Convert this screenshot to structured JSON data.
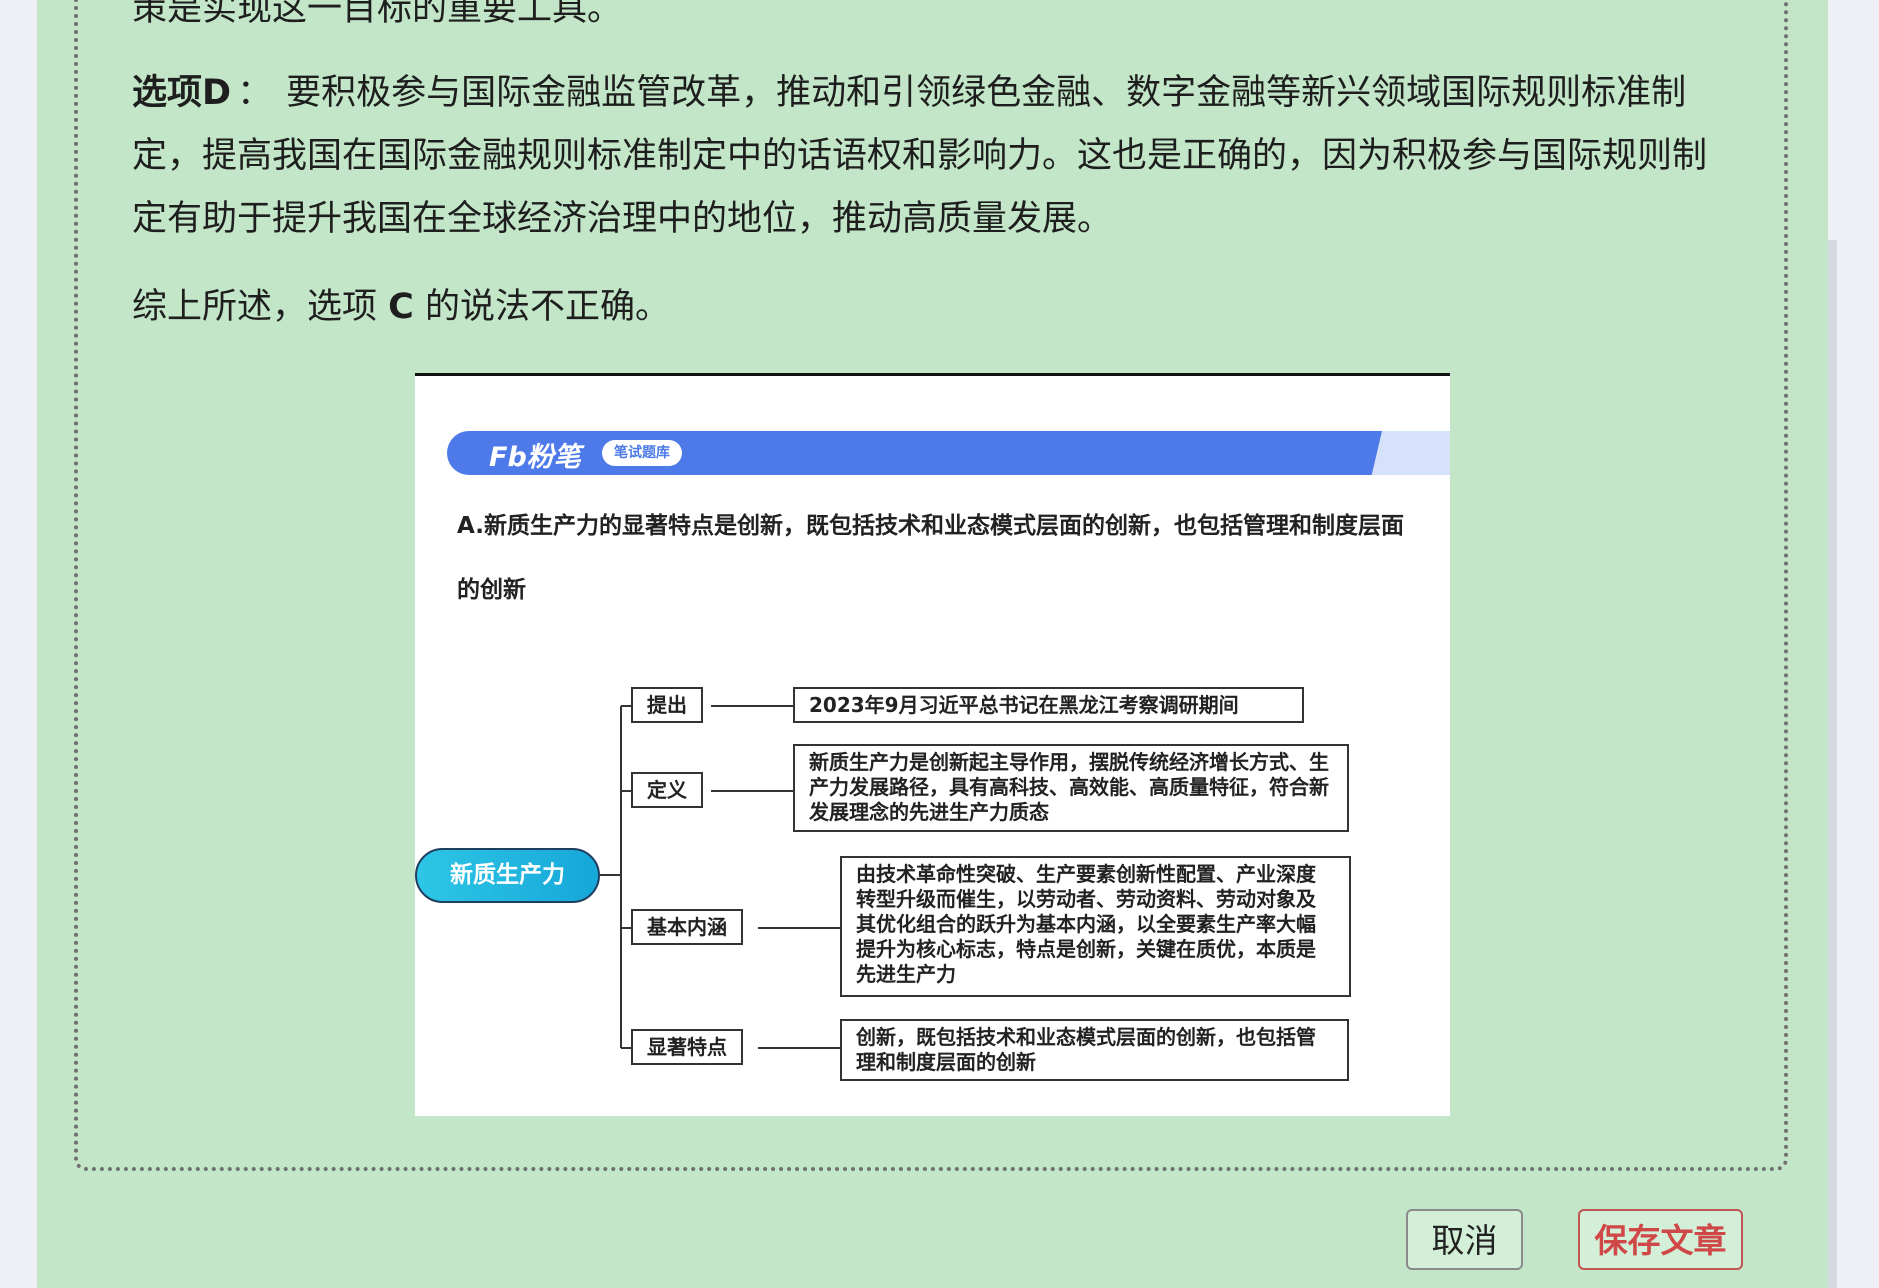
{
  "article": {
    "top_partial": "策是实现这一目标的重要工具。",
    "option_d_key": "选项D",
    "option_d_colon": "：",
    "option_d_text": "要积极参与国际金融监管改革，推动和引领绿色金融、数字金融等新兴领域国际规则标准制定，提高我国在国际金融规则标准制定中的话语权和影响力。这也是正确的，因为积极参与国际规则制定有助于提升我国在全球经济治理中的地位，推动高质量发展。",
    "summary_prefix": "综上所述，选项 ",
    "summary_option": "C",
    "summary_suffix": " 的说法不正确。"
  },
  "image": {
    "logo_text": "Fb粉笔",
    "logo_tag": "笔试题库",
    "question": "A.新质生产力的显著特点是创新，既包括技术和业态模式层面的创新，也包括管理和制度层面的创新",
    "root": "新质生产力",
    "branches": [
      {
        "label": "提出",
        "text": "2023年9月习近平总书记在黑龙江考察调研期间"
      },
      {
        "label": "定义",
        "text": "新质生产力是创新起主导作用，摆脱传统经济增长方式、生产力发展路径，具有高科技、高效能、高质量特征，符合新发展理念的先进生产力质态"
      },
      {
        "label": "基本内涵",
        "text": "由技术革命性突破、生产要素创新性配置、产业深度转型升级而催生，以劳动者、劳动资料、劳动对象及其优化组合的跃升为基本内涵，以全要素生产率大幅提升为核心标志，特点是创新，关键在质优，本质是先进生产力"
      },
      {
        "label": "显著特点",
        "text": "创新，既包括技术和业态模式层面的创新，也包括管理和制度层面的创新"
      }
    ]
  },
  "footer": {
    "cancel_label": "取消",
    "save_label": "保存文章"
  },
  "colors": {
    "panel_bg": "#c2e6c7",
    "brand_blue": "#4d7ae8",
    "save_red": "#cf4747"
  }
}
